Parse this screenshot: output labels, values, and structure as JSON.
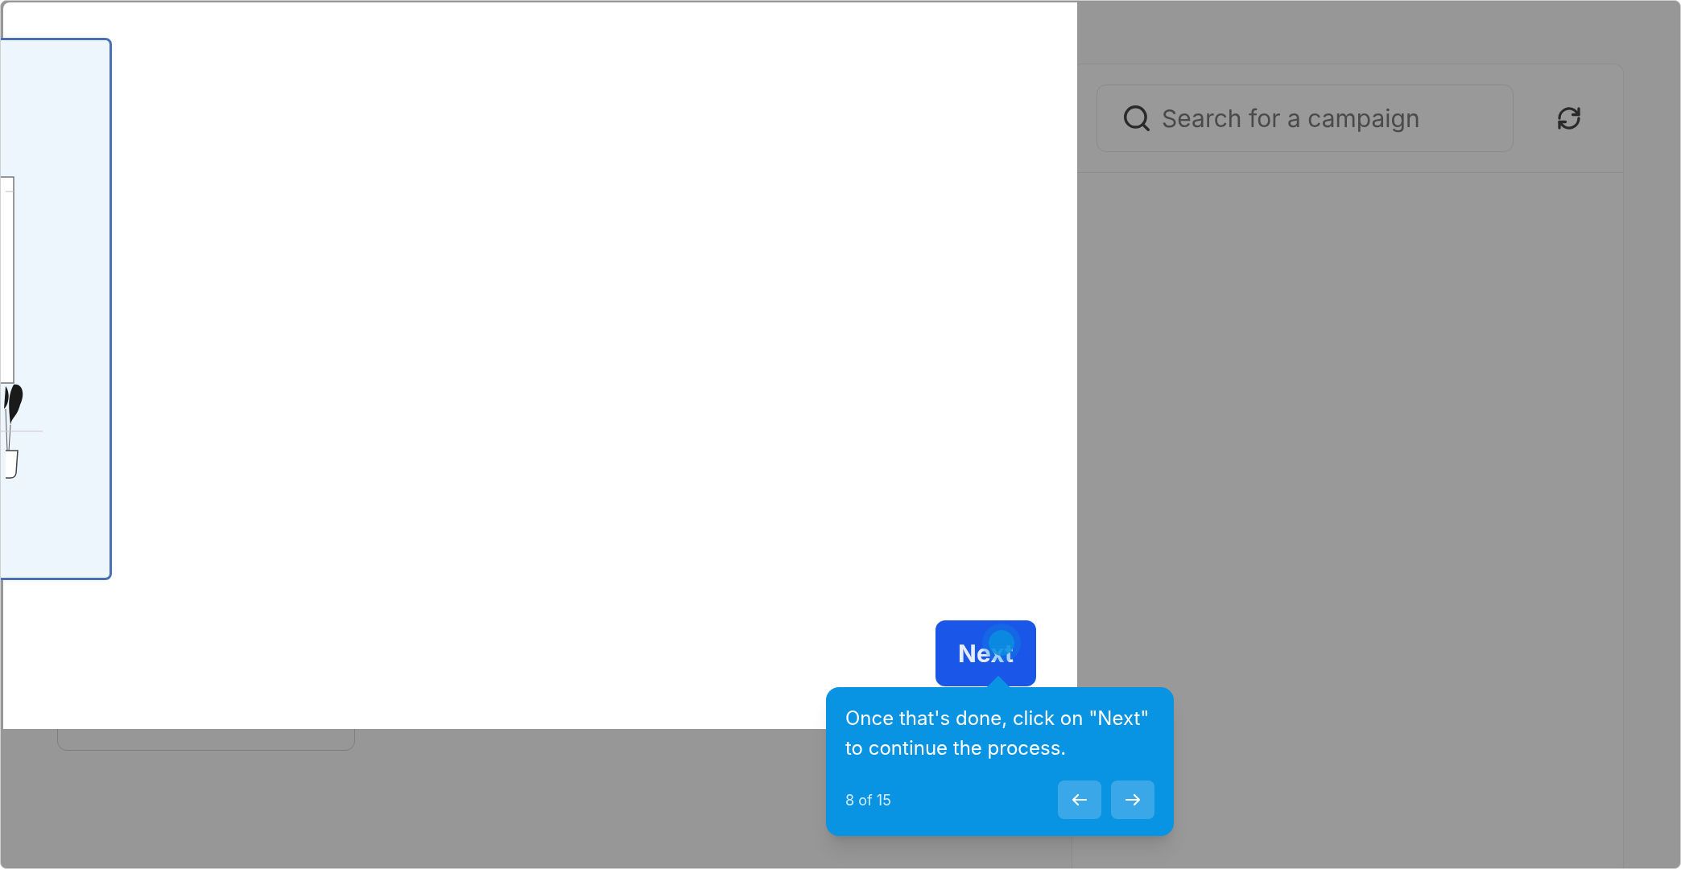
{
  "background": {
    "search": {
      "placeholder": "Search for a campaign"
    }
  },
  "dialog": {
    "next_button": {
      "label": "Next"
    }
  },
  "tooltip": {
    "text": "Once that's done, click on \"Next\" to continue the process.",
    "step": "8 of 15"
  }
}
